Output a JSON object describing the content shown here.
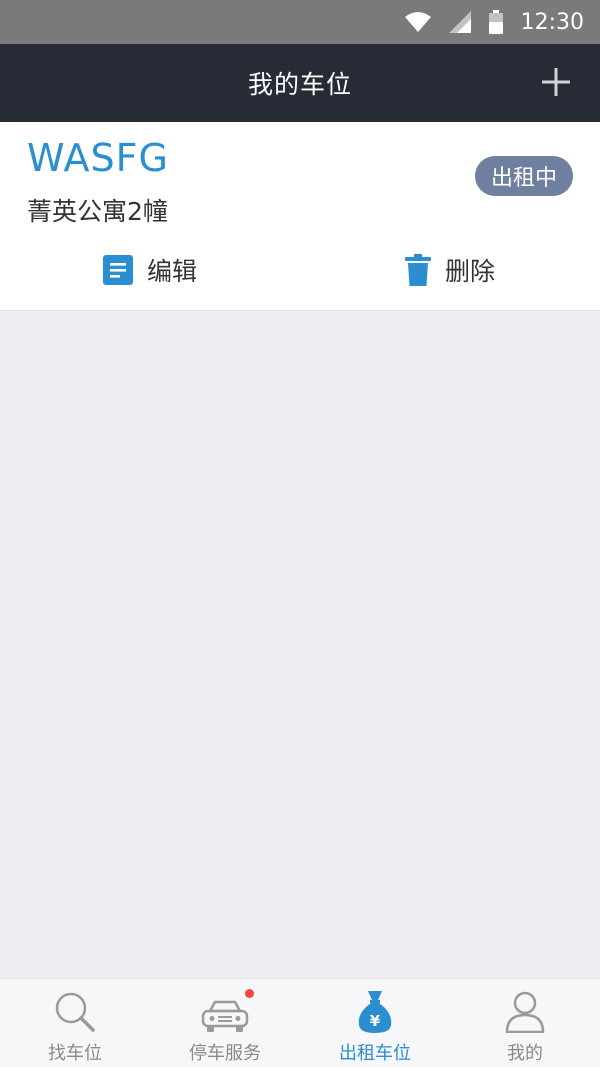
{
  "status_bar": {
    "time": "12:30",
    "icons": [
      "wifi-icon",
      "signal-icon",
      "battery-icon"
    ]
  },
  "header": {
    "title": "我的车位",
    "add_icon": "plus-icon"
  },
  "spot": {
    "plate": "WASFG",
    "location": "菁英公寓2幢",
    "status": "出租中",
    "actions": {
      "edit_label": "编辑",
      "edit_icon": "document-icon",
      "delete_label": "删除",
      "delete_icon": "trash-icon"
    }
  },
  "bottom_nav": {
    "items": [
      {
        "label": "找车位",
        "icon": "search-icon",
        "active": false
      },
      {
        "label": "停车服务",
        "icon": "car-icon",
        "active": false,
        "badge": true
      },
      {
        "label": "出租车位",
        "icon": "money-bag-icon",
        "active": true
      },
      {
        "label": "我的",
        "icon": "user-icon",
        "active": false
      }
    ]
  },
  "colors": {
    "accent": "#2a8ed0",
    "header_bg": "#272b35",
    "badge_bg": "#6f7fa0",
    "page_bg": "#eeeef2",
    "notification_dot": "#f04a3e"
  }
}
